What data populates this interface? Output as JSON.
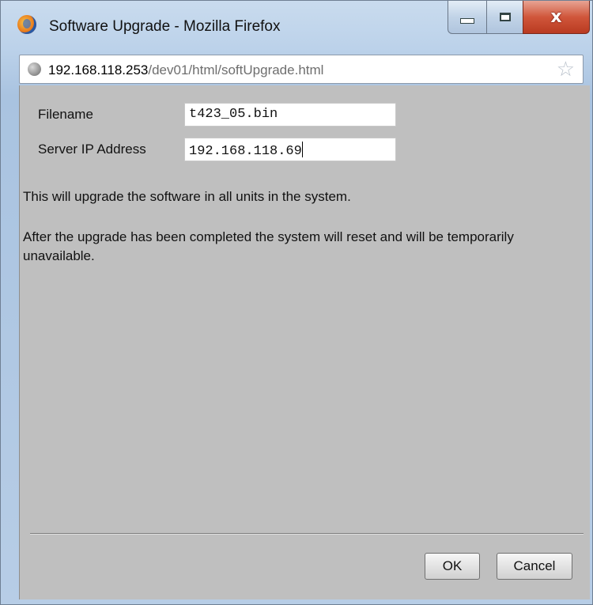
{
  "window": {
    "title": "Software Upgrade - Mozilla Firefox",
    "controls": {
      "minimize_icon": "minimize-icon",
      "maximize_icon": "maximize-icon",
      "close_glyph": "x"
    }
  },
  "urlbar": {
    "host": "192.168.118.253",
    "path": "/dev01/html/softUpgrade.html",
    "bookmark_icon": "star-icon"
  },
  "form": {
    "filename_label": "Filename",
    "filename_value": "t423_05.bin",
    "server_ip_label": "Server IP Address",
    "server_ip_value": "192.168.118.69"
  },
  "messages": {
    "line1": "This will upgrade the software in all units in the system.",
    "line2": "After the upgrade has been completed the system will reset and will be temporarily unavailable."
  },
  "buttons": {
    "ok": "OK",
    "cancel": "Cancel"
  }
}
